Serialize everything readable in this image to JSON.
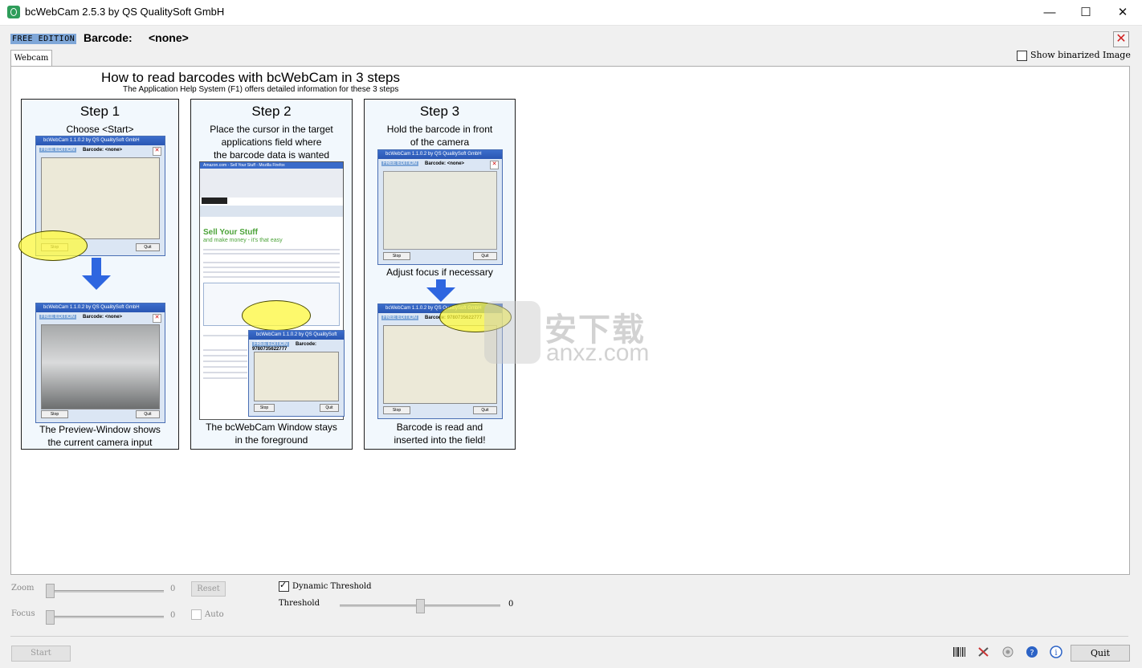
{
  "window": {
    "title": "bcWebCam 2.5.3 by QS QualitySoft GmbH",
    "minimize": "—",
    "maximize": "☐",
    "close": "✕"
  },
  "header": {
    "edition_badge": "FREE EDITION",
    "barcode_label": "Barcode:",
    "barcode_value": "<none>",
    "close_symbol": "✕"
  },
  "tabs": [
    {
      "label": "Webcam",
      "active": true
    }
  ],
  "options": {
    "show_binarized": "Show binarized Image"
  },
  "tutorial": {
    "title": "How to read barcodes with bcWebCam in 3 steps",
    "subtitle": "The Application Help System (F1) offers detailed information for these 3 steps",
    "steps": [
      {
        "title": "Step 1",
        "top_text": "Choose <Start>",
        "bottom_text": "The Preview-Window shows\nthe current camera input"
      },
      {
        "title": "Step 2",
        "top_text": "Place the cursor in the target\napplications field where\nthe barcode data is wanted",
        "bottom_text": "The bcWebCam Window stays\nin the foreground"
      },
      {
        "title": "Step 3",
        "top_text": "Hold the barcode in front\nof the camera",
        "middle_text": "Adjust focus if necessary",
        "bottom_text": "Barcode is read and\ninserted into the field!"
      }
    ],
    "mini_window": {
      "title": "bcWebCam 1.1.0.2 by QS QualitySoft GmbH",
      "badge": "FREE EDITION",
      "barcode_label": "Barcode:",
      "none_value": "<none>",
      "read_value": "9780735622777",
      "stop": "Stop",
      "quit": "Quit"
    },
    "browser": {
      "title": "Amazon.com - Sell Your Stuff - Mozilla Firefox",
      "headline": "Sell Your Stuff",
      "tagline": "and make money - it's that easy"
    }
  },
  "controls": {
    "zoom_label": "Zoom",
    "zoom_value": "0",
    "reset": "Reset",
    "focus_label": "Focus",
    "focus_value": "0",
    "auto": "Auto",
    "dynamic_threshold": "Dynamic Threshold",
    "dynamic_threshold_checked": true,
    "threshold_label": "Threshold",
    "threshold_value": "0",
    "threshold_level": 0.5
  },
  "footer": {
    "start": "Start",
    "quit": "Quit",
    "tools": [
      "barcode-icon",
      "tools-icon",
      "camera-icon",
      "help-icon",
      "info-icon"
    ]
  },
  "watermark": {
    "cn": "安下载",
    "en": "anxz.com"
  }
}
